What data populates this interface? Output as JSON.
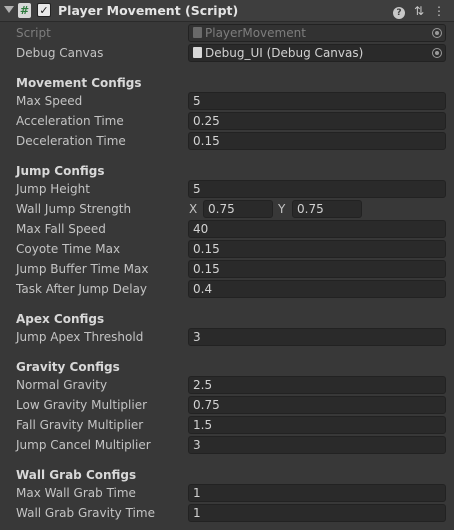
{
  "header": {
    "script_glyph": "#",
    "enabled_glyph": "✓",
    "title": "Player Movement (Script)",
    "help_glyph": "?",
    "preset_glyph": "⇅",
    "menu_glyph": "⋮"
  },
  "script_row": {
    "label": "Script",
    "value": "PlayerMovement"
  },
  "debug_row": {
    "label": "Debug Canvas",
    "value": "Debug_UI (Debug Canvas)"
  },
  "movement": {
    "title": "Movement Configs",
    "max_speed": {
      "label": "Max Speed",
      "value": "5"
    },
    "acceleration": {
      "label": "Acceleration Time",
      "value": "0.25"
    },
    "deceleration": {
      "label": "Deceleration Time",
      "value": "0.15"
    }
  },
  "jump": {
    "title": "Jump Configs",
    "height": {
      "label": "Jump Height",
      "value": "5"
    },
    "wall_jump": {
      "label": "Wall Jump Strength",
      "x_label": "X",
      "x_value": "0.75",
      "y_label": "Y",
      "y_value": "0.75"
    },
    "max_fall": {
      "label": "Max Fall Speed",
      "value": "40"
    },
    "coyote": {
      "label": "Coyote Time Max",
      "value": "0.15"
    },
    "buffer": {
      "label": "Jump Buffer Time Max",
      "value": "0.15"
    },
    "task_delay": {
      "label": "Task After Jump Delay",
      "value": "0.4"
    }
  },
  "apex": {
    "title": "Apex Configs",
    "threshold": {
      "label": "Jump Apex Threshold",
      "value": "3"
    }
  },
  "gravity": {
    "title": "Gravity Configs",
    "normal": {
      "label": "Normal Gravity",
      "value": "2.5"
    },
    "low_mult": {
      "label": "Low Gravity Multiplier",
      "value": "0.75"
    },
    "fall_mult": {
      "label": "Fall Gravity Multiplier",
      "value": "1.5"
    },
    "cancel_mult": {
      "label": "Jump Cancel Multiplier",
      "value": "3"
    }
  },
  "wall_grab": {
    "title": "Wall Grab Configs",
    "max_time": {
      "label": "Max Wall Grab Time",
      "value": "1"
    },
    "gravity_time": {
      "label": "Wall Grab Gravity Time",
      "value": "1"
    }
  }
}
